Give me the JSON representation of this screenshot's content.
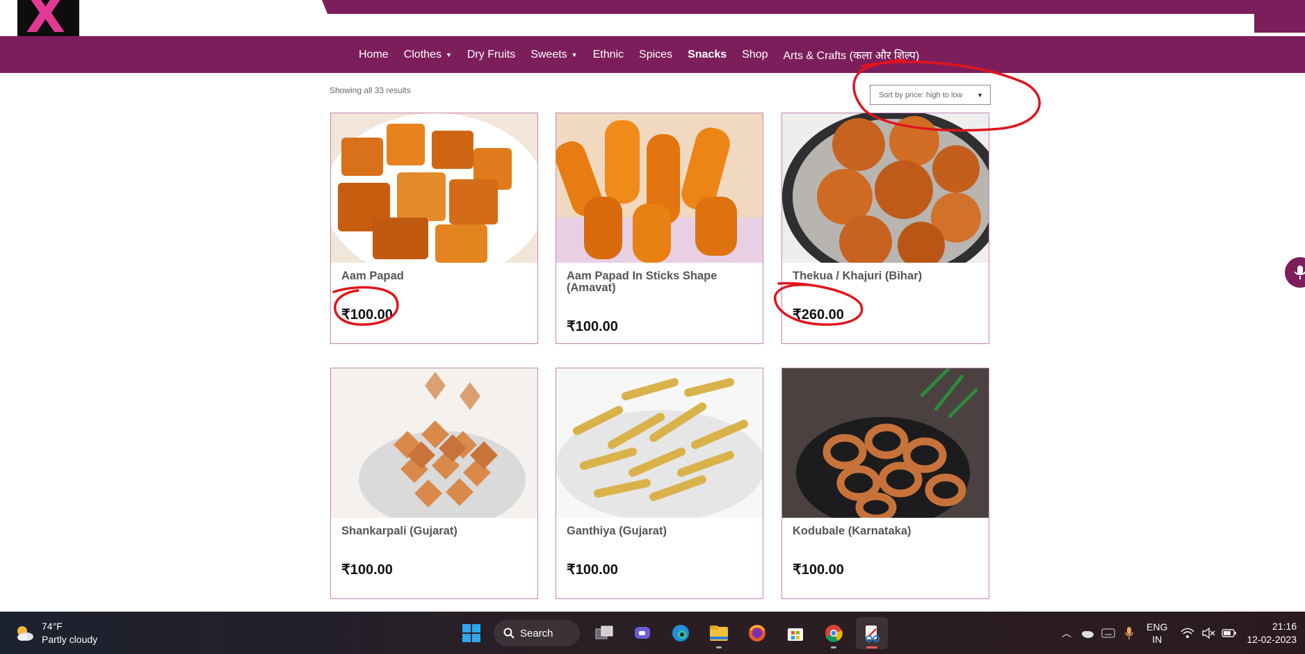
{
  "brand": {
    "logo_letter": "X",
    "logo_color": "#e23a94",
    "primary_color": "#7c1e5c"
  },
  "nav": {
    "items": [
      {
        "label": "Home",
        "has_dropdown": false,
        "active": false
      },
      {
        "label": "Clothes",
        "has_dropdown": true,
        "active": false
      },
      {
        "label": "Dry Fruits",
        "has_dropdown": false,
        "active": false
      },
      {
        "label": "Sweets",
        "has_dropdown": true,
        "active": false
      },
      {
        "label": "Ethnic",
        "has_dropdown": false,
        "active": false
      },
      {
        "label": "Spices",
        "has_dropdown": false,
        "active": false
      },
      {
        "label": "Snacks",
        "has_dropdown": false,
        "active": true
      },
      {
        "label": "Shop",
        "has_dropdown": false,
        "active": false
      },
      {
        "label": "Arts & Crafts (कला और शिल्प)",
        "has_dropdown": false,
        "active": false
      }
    ]
  },
  "shop": {
    "results_text": "Showing all 33 results",
    "sort_selected": "Sort by price: high to low"
  },
  "products": [
    {
      "name": "Aam Papad",
      "price": "₹100.00",
      "image": "aam-papad-photo"
    },
    {
      "name": "Aam Papad In Sticks Shape (Amavat)",
      "price": "₹100.00",
      "image": "aam-papad-sticks-photo"
    },
    {
      "name": "Thekua / Khajuri (Bihar)",
      "price": "₹260.00",
      "image": "thekua-photo"
    },
    {
      "name": "Shankarpali (Gujarat)",
      "price": "₹100.00",
      "image": "shankarpali-photo"
    },
    {
      "name": "Ganthiya (Gujarat)",
      "price": "₹100.00",
      "image": "ganthiya-photo"
    },
    {
      "name": "Kodubale (Karnataka)",
      "price": "₹100.00",
      "image": "kodubale-photo"
    }
  ],
  "annotations": {
    "color": "#e0141c",
    "circled": [
      "sort-dropdown",
      "price-aam-papad",
      "price-thekua"
    ]
  },
  "taskbar": {
    "weather_temp": "74°F",
    "weather_desc": "Partly cloudy",
    "search_label": "Search",
    "apps": [
      "windows-start-icon",
      "task-view-icon",
      "chat-icon",
      "edge-icon",
      "file-explorer-icon",
      "firefox-icon",
      "store-icon",
      "chrome-icon",
      "snipping-tool-icon"
    ],
    "lang_line1": "ENG",
    "lang_line2": "IN",
    "time": "21:16",
    "date": "12-02-2023"
  }
}
